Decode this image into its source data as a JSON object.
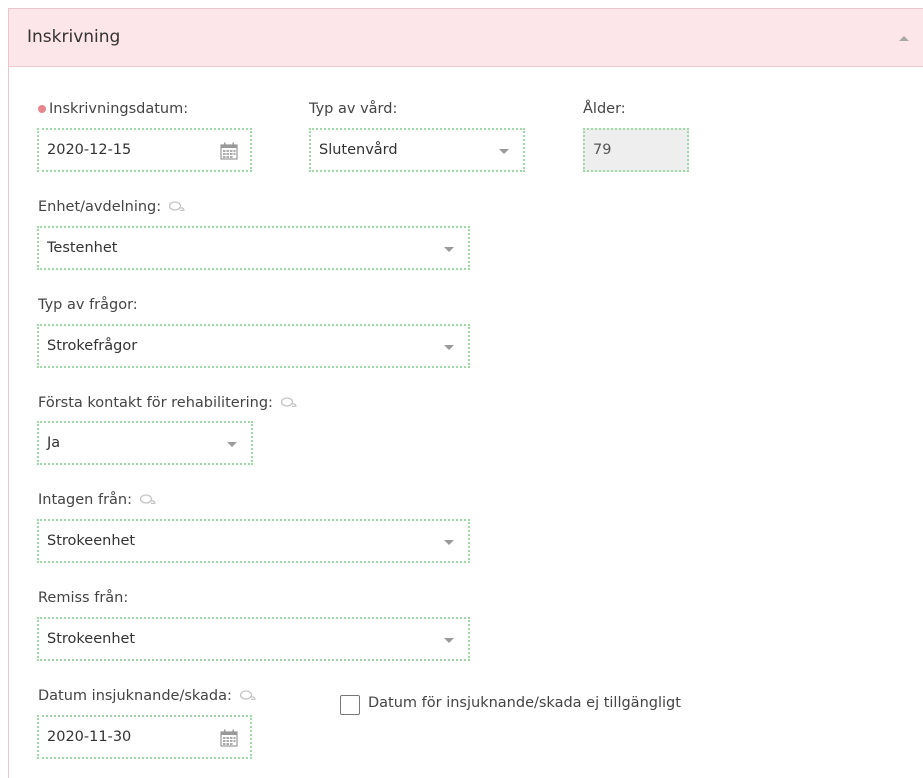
{
  "section": {
    "title": "Inskrivning"
  },
  "fields": {
    "inskrivningsdatum": {
      "label": "Inskrivningsdatum:",
      "value": "2020-12-15"
    },
    "typ_av_vard": {
      "label": "Typ av vård:",
      "value": "Slutenvård"
    },
    "alder": {
      "label": "Ålder:",
      "value": "79"
    },
    "enhet": {
      "label": "Enhet/avdelning:",
      "value": "Testenhet"
    },
    "typ_av_fragor": {
      "label": "Typ av frågor:",
      "value": "Strokefrågor"
    },
    "forsta_kontakt": {
      "label": "Första kontakt för rehabilitering:",
      "value": "Ja"
    },
    "intagen_fran": {
      "label": "Intagen från:",
      "value": "Strokeenhet"
    },
    "remiss_fran": {
      "label": "Remiss från:",
      "value": "Strokeenhet"
    },
    "datum_insjuknande": {
      "label": "Datum insjuknande/skada:",
      "value": "2020-11-30"
    },
    "datum_ej_tillgangligt": {
      "label": "Datum för insjuknande/skada ej tillgängligt",
      "checked": false
    }
  },
  "icons": {
    "comment": "comment-icon",
    "calendar": "calendar-icon",
    "dropdown": "chevron-down-icon",
    "collapse": "chevron-up-icon"
  },
  "colors": {
    "header_bg": "#fde6ea",
    "field_border": "#9fd9a7",
    "required_dot": "#e8868f"
  }
}
